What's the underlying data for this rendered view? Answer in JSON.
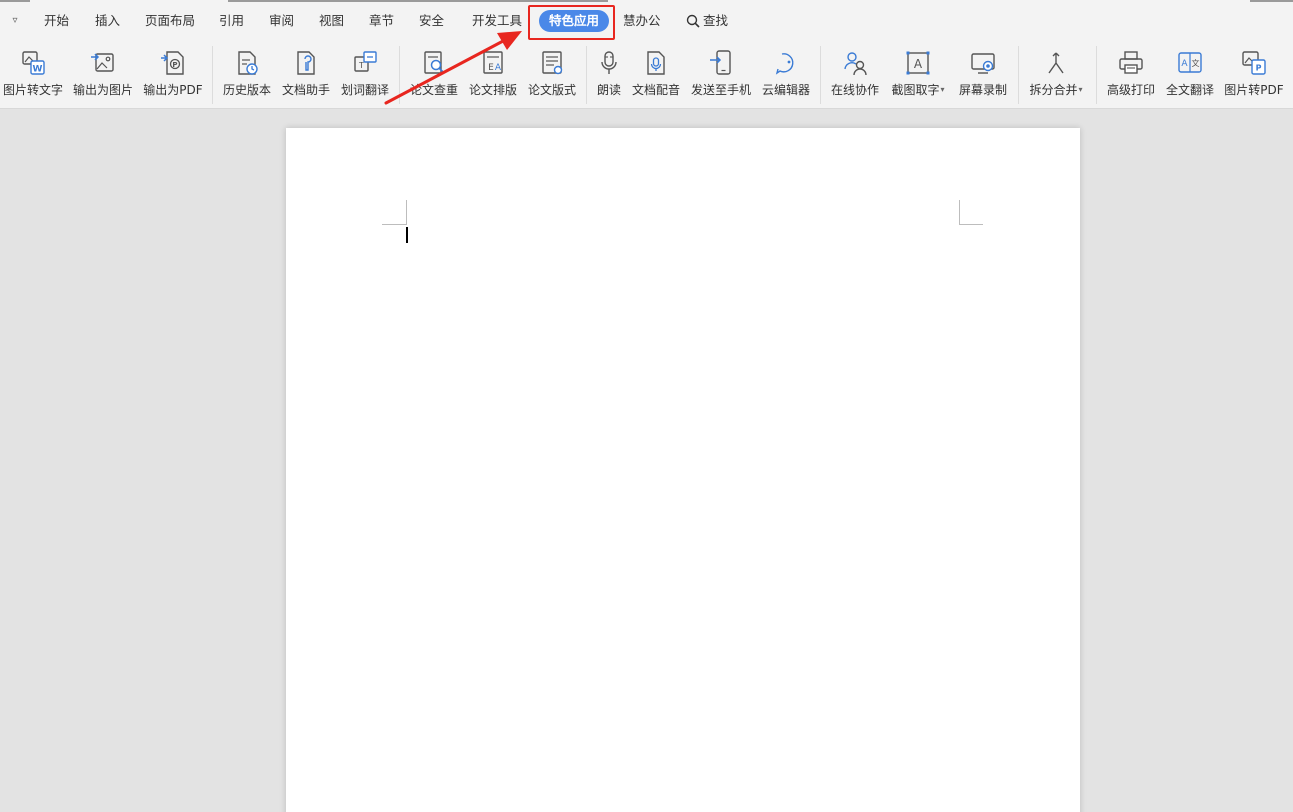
{
  "menu": {
    "collapse_glyph": "▿",
    "items": [
      "开始",
      "插入",
      "页面布局",
      "引用",
      "审阅",
      "视图",
      "章节",
      "安全",
      "开发工具",
      "特色应用",
      "慧办公"
    ],
    "active_index": 9,
    "search_label": "查找"
  },
  "toolbar": {
    "tools": [
      {
        "label": "图片转文字",
        "icon": "image-to-text-icon"
      },
      {
        "label": "输出为图片",
        "icon": "export-image-icon"
      },
      {
        "label": "输出为PDF",
        "icon": "export-pdf-icon"
      },
      {
        "label": "历史版本",
        "icon": "history-version-icon"
      },
      {
        "label": "文档助手",
        "icon": "doc-assistant-icon"
      },
      {
        "label": "划词翻译",
        "icon": "word-translate-icon"
      },
      {
        "label": "论文查重",
        "icon": "paper-check-icon"
      },
      {
        "label": "论文排版",
        "icon": "paper-layout-icon"
      },
      {
        "label": "论文版式",
        "icon": "paper-format-icon"
      },
      {
        "label": "朗读",
        "icon": "read-aloud-icon"
      },
      {
        "label": "文档配音",
        "icon": "doc-voice-icon"
      },
      {
        "label": "发送至手机",
        "icon": "send-to-phone-icon"
      },
      {
        "label": "云编辑器",
        "icon": "cloud-editor-icon"
      },
      {
        "label": "在线协作",
        "icon": "online-collab-icon"
      },
      {
        "label": "截图取字",
        "icon": "screenshot-text-icon",
        "dropdown": true
      },
      {
        "label": "屏幕录制",
        "icon": "screen-record-icon"
      },
      {
        "label": "拆分合并",
        "icon": "split-merge-icon",
        "dropdown": true
      },
      {
        "label": "高级打印",
        "icon": "advanced-print-icon"
      },
      {
        "label": "全文翻译",
        "icon": "full-translate-icon"
      },
      {
        "label": "图片转PDF",
        "icon": "image-to-pdf-icon"
      }
    ],
    "dropdown_glyph": "▾"
  },
  "colors": {
    "accent": "#4a88e8",
    "highlight": "#e8261f",
    "icon_blue": "#3a7bd5",
    "icon_gray": "#555555"
  }
}
